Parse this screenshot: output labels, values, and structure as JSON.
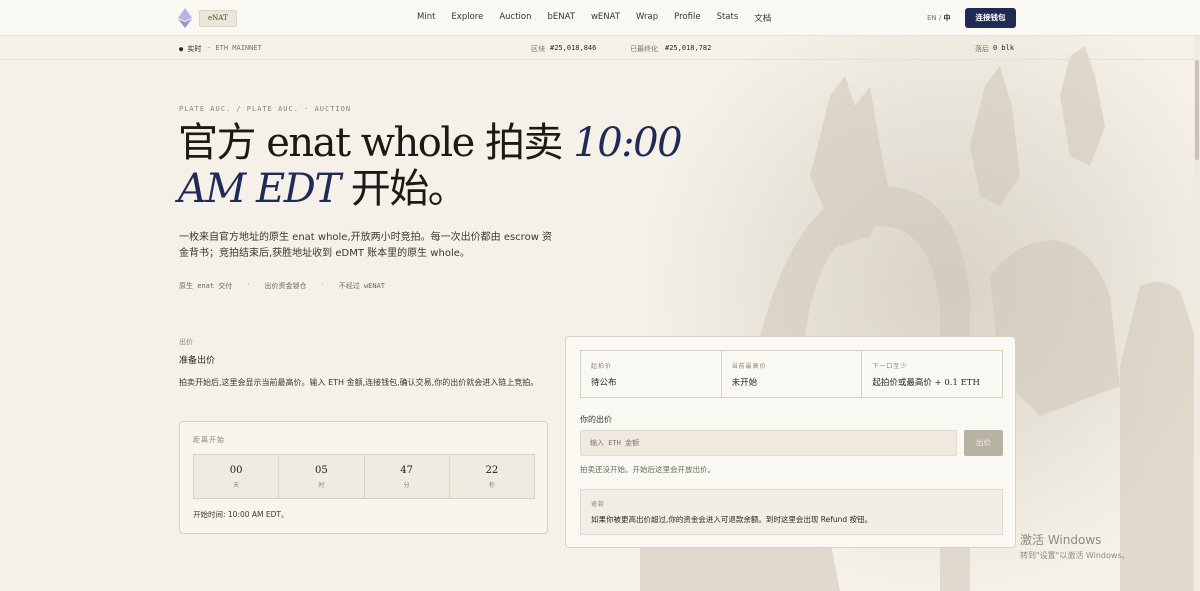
{
  "nav": {
    "brand": "eNAT",
    "links": [
      "Mint",
      "Explore",
      "Auction",
      "bENAT",
      "wENAT",
      "Wrap",
      "Profile",
      "Stats",
      "文档"
    ],
    "lang_en": "EN",
    "lang_sep": "/",
    "lang_zh": "中",
    "connect": "连接钱包"
  },
  "status": {
    "live": "● 实时",
    "network": "· ETH MAINNET",
    "block_label": "区块",
    "block_value": "#25,018,846",
    "final_label": "已最终化",
    "final_value": "#25,018,782",
    "lag_label": "落后",
    "lag_value": "0 blk"
  },
  "hero": {
    "breadcrumb": "PLATE AUC.  /  PLATE AUC. · AUCTION",
    "title_main": "官方 enat whole 拍卖 ",
    "title_time": "10:00 AM EDT",
    "title_end": " 开始。",
    "desc": "一枚来自官方地址的原生 enat whole,开放两小时竞拍。每一次出价都由 escrow 资金背书；竞拍结束后,获胜地址收到 eDMT 账本里的原生 whole。",
    "tags": [
      "原生 enat 交付",
      "·",
      "出价资金锁仓",
      "·",
      "不经过 wENAT"
    ]
  },
  "bid_section": {
    "label": "出价",
    "title": "准备出价",
    "desc": "拍卖开始后,这里会显示当前最高价。输入 ETH 金额,连接钱包,确认交易,你的出价就会进入链上竞拍。"
  },
  "countdown": {
    "label": "距离开始",
    "days": "00",
    "days_unit": "天",
    "hours": "05",
    "hours_unit": "时",
    "minutes": "47",
    "minutes_unit": "分",
    "seconds": "22",
    "seconds_unit": "秒",
    "start_text": "开始时间: 10:00 AM EDT。"
  },
  "panel": {
    "start_price_label": "起拍价",
    "start_price_value": "待公布",
    "current_high_label": "当前最高价",
    "current_high_value": "未开始",
    "next_min_label": "下一口至少",
    "next_min_value": "起拍价或最高价 + 0.1 ETH",
    "your_bid_label": "你的出价",
    "input_placeholder": "输入 ETH 金额",
    "bid_button": "出价",
    "note": "拍卖还没开始。开始后这里会开放出价。",
    "refund_label": "退款",
    "refund_text": "如果你被更高出价超过,你的资金会进入可退款余额。到时这里会出现 Refund 按钮。"
  },
  "watermark": {
    "title": "激活 Windows",
    "sub": "转到\"设置\"以激活 Windows。"
  }
}
